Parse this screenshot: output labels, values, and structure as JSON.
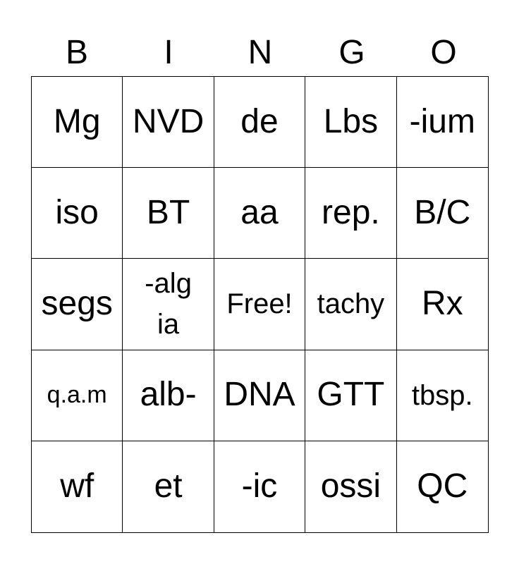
{
  "header": [
    "B",
    "I",
    "N",
    "G",
    "O"
  ],
  "cells": [
    [
      "Mg",
      "NVD",
      "de",
      "Lbs",
      "-ium"
    ],
    [
      "iso",
      "BT",
      "aa",
      "rep.",
      "B/C"
    ],
    [
      "segs",
      "-algia",
      "Free!",
      "tachy",
      "Rx"
    ],
    [
      "q.a.m",
      "alb-",
      "DNA",
      "GTT",
      "tbsp."
    ],
    [
      "wf",
      "et",
      "-ic",
      "ossi",
      "QC"
    ]
  ]
}
